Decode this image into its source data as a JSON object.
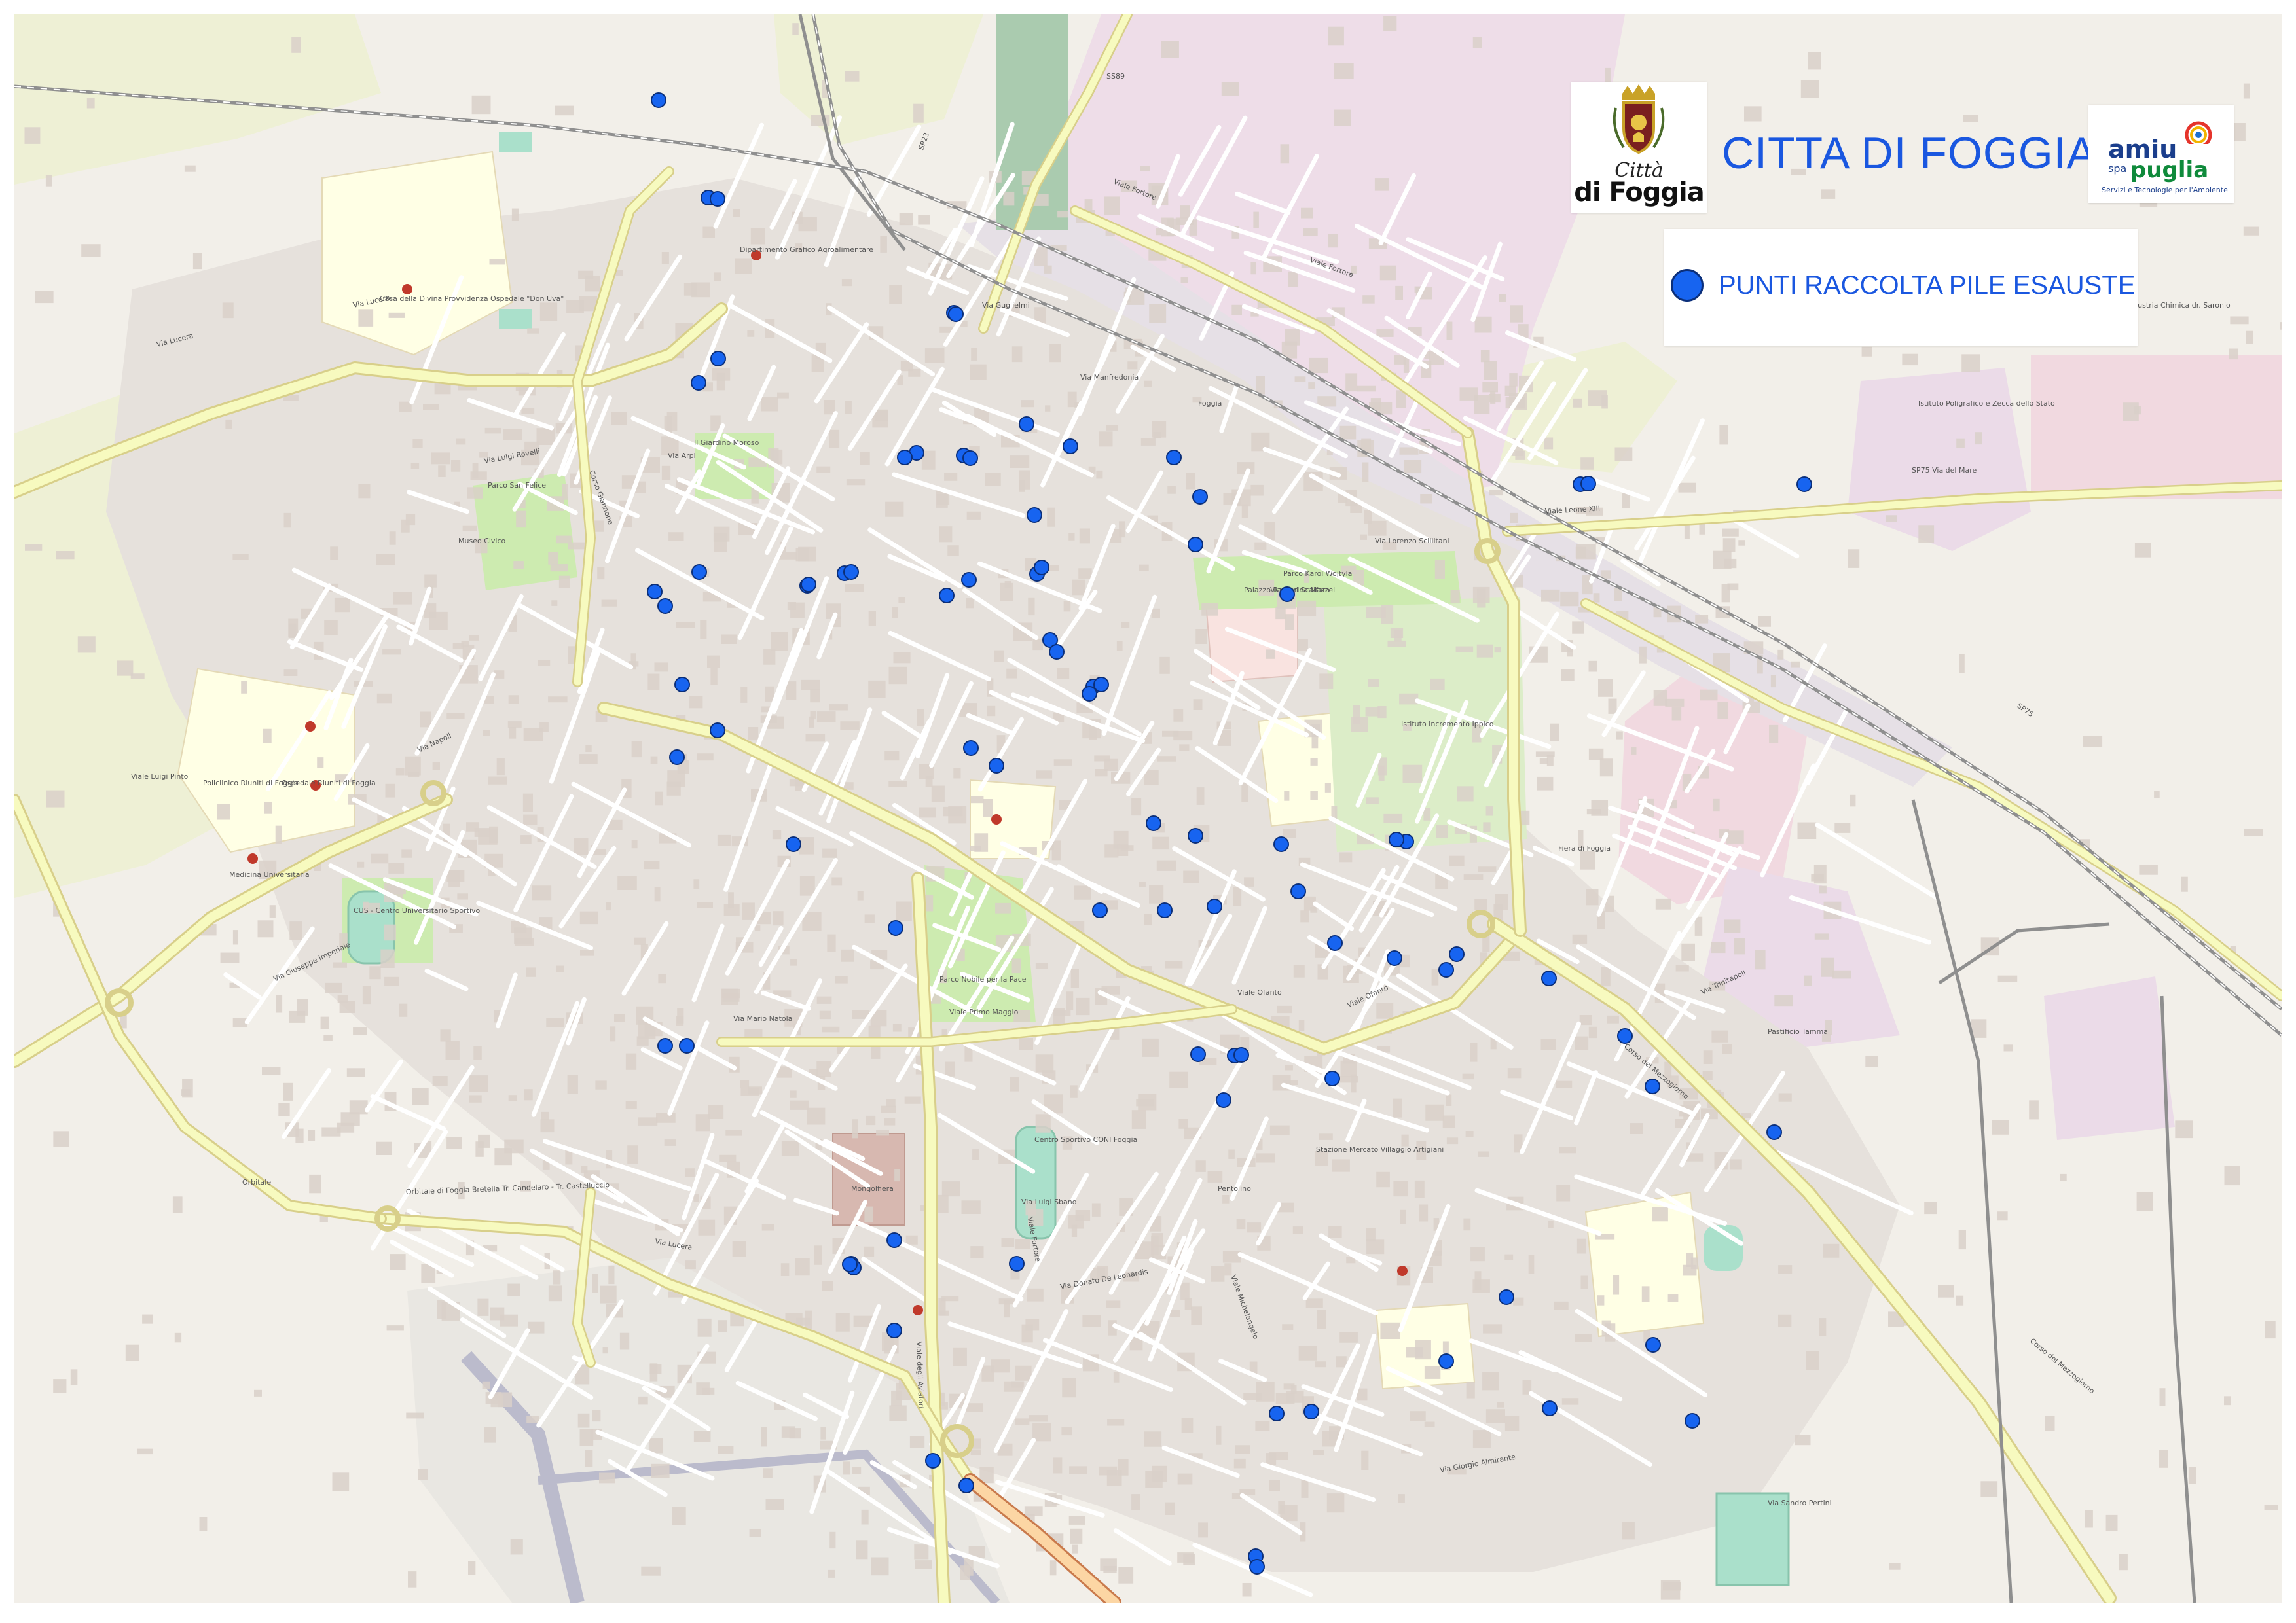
{
  "header": {
    "city_title": "CITTA DI FOGGIA",
    "city_logo_line1": "Città",
    "city_logo_line2": "di Foggia",
    "amiu_logo_name": "amiu",
    "amiu_logo_spa": "spa",
    "amiu_logo_region": "puglia",
    "amiu_logo_tagline": "Servizi e Tecnologie per l'Ambiente"
  },
  "legend": {
    "label": "PUNTI RACCOLTA PILE ESAUSTE",
    "marker_color": "#1764f0",
    "marker_stroke": "#0b2f7a"
  },
  "colors": {
    "map_background": "#f2efe9",
    "building": "#d9d0c9",
    "road": "#ffffff",
    "primary_road": "#f7fabf",
    "residential_pink": "#eedde8",
    "park": "#cdebb0",
    "pitch": "#aae0cb",
    "railway": "#9a9a9a",
    "motorway": "#e892a2",
    "institution": "#ffffe5",
    "industrial": "#ebdbe8",
    "runway": "#bbbbcc",
    "label_text": "#555555",
    "poi_red": "#c0392b"
  },
  "map_labels": [
    {
      "text": "Via Lucera"
    },
    {
      "text": "Via Lucera"
    },
    {
      "text": "Viale Fortore"
    },
    {
      "text": "Via Manfredonia"
    },
    {
      "text": "Via Napoli"
    },
    {
      "text": "Viale Luigi Pinto"
    },
    {
      "text": "Viale Ofanto"
    },
    {
      "text": "Viale Ofanto"
    },
    {
      "text": "Via Mario Natola"
    },
    {
      "text": "Viale Primo Maggio"
    },
    {
      "text": "Corso del Mezzogiorno"
    },
    {
      "text": "Viale Michelangelo"
    },
    {
      "text": "Viale degli Aviatori"
    },
    {
      "text": "Via Trinitapoli"
    },
    {
      "text": "Viale Fortore"
    },
    {
      "text": "Viale Leone XIII"
    },
    {
      "text": "Via Lorenzo Scillitani"
    },
    {
      "text": "Via Marina Mazzei"
    },
    {
      "text": "Via Giuseppe Imperiale"
    },
    {
      "text": "Corso del Mezzogiorno"
    },
    {
      "text": "Corso Giannone"
    },
    {
      "text": "Via Arpi"
    },
    {
      "text": "Via Luigi Rovelli"
    },
    {
      "text": "Via Guglielmi"
    },
    {
      "text": "Via Luigi Sbano"
    },
    {
      "text": "Via Donato De Leonardis"
    },
    {
      "text": "Via Giorgio Almirante"
    },
    {
      "text": "Via Sandro Pertini"
    },
    {
      "text": "Orbitale di Foggia Bretella Tr. Candelaro - Tr. Castelluccio"
    },
    {
      "text": "Orbitale"
    },
    {
      "text": "Via Lucera"
    },
    {
      "text": "Viale Fortore"
    },
    {
      "text": "SP75 Via del Mare"
    },
    {
      "text": "SP75"
    },
    {
      "text": "SP23"
    },
    {
      "text": "SS89"
    },
    {
      "text": "Parco San Felice"
    },
    {
      "text": "Parco Nobile per la Pace"
    },
    {
      "text": "Il Giardino Moroso"
    },
    {
      "text": "Istituto Incremento Ippico"
    },
    {
      "text": "Fiera di Foggia"
    },
    {
      "text": "Istituto Poligrafico e Zecca dello Stato"
    },
    {
      "text": "EX Industria Chimica dr. Saronio"
    },
    {
      "text": "Policlinico Riuniti di Foggia"
    },
    {
      "text": "Ospedale Riuniti di Foggia"
    },
    {
      "text": "Medicina Universitaria"
    },
    {
      "text": "Casa della Divina Provvidenza Ospedale \"Don Uva\""
    },
    {
      "text": "Dipartimento Grafico Agroalimentare"
    },
    {
      "text": "CUS - Centro Universitario Sportivo"
    },
    {
      "text": "Centro Sportivo CONI Foggia"
    },
    {
      "text": "Mongolfiera"
    },
    {
      "text": "Pastificio Tamma"
    },
    {
      "text": "Stazione Mercato Villaggio Artigiani"
    },
    {
      "text": "Palazzo Ranieri Scalfaro"
    },
    {
      "text": "Museo Civico"
    },
    {
      "text": "Foggia"
    },
    {
      "text": "Parco Karol Wojtyla"
    },
    {
      "text": "Pentolino"
    }
  ],
  "battery_collection_points": [
    [
      1006,
      153
    ],
    [
      1082,
      302
    ],
    [
      1096,
      304
    ],
    [
      1097,
      548
    ],
    [
      1067,
      585
    ],
    [
      1457,
      478
    ],
    [
      1460,
      480
    ],
    [
      1400,
      692
    ],
    [
      1382,
      699
    ],
    [
      1472,
      696
    ],
    [
      1482,
      700
    ],
    [
      1568,
      648
    ],
    [
      1635,
      682
    ],
    [
      1580,
      787
    ],
    [
      1584,
      877
    ],
    [
      1480,
      886
    ],
    [
      1446,
      910
    ],
    [
      1591,
      867
    ],
    [
      1793,
      699
    ],
    [
      1833,
      759
    ],
    [
      1826,
      832
    ],
    [
      1966,
      908
    ],
    [
      1068,
      874
    ],
    [
      1290,
      876
    ],
    [
      1300,
      874
    ],
    [
      1233,
      895
    ],
    [
      1235,
      893
    ],
    [
      1000,
      904
    ],
    [
      1016,
      926
    ],
    [
      1042,
      1046
    ],
    [
      1096,
      1116
    ],
    [
      1034,
      1157
    ],
    [
      1604,
      978
    ],
    [
      1614,
      996
    ],
    [
      1670,
      1049
    ],
    [
      1664,
      1060
    ],
    [
      1682,
      1046
    ],
    [
      1483,
      1143
    ],
    [
      1522,
      1170
    ],
    [
      1762,
      1258
    ],
    [
      1826,
      1277
    ],
    [
      1957,
      1290
    ],
    [
      1212,
      1290
    ],
    [
      1368,
      1418
    ],
    [
      1680,
      1391
    ],
    [
      1779,
      1391
    ],
    [
      1855,
      1385
    ],
    [
      1983,
      1362
    ],
    [
      2148,
      1286
    ],
    [
      2133,
      1283
    ],
    [
      2039,
      1441
    ],
    [
      2130,
      1464
    ],
    [
      2225,
      1458
    ],
    [
      2209,
      1482
    ],
    [
      2366,
      1495
    ],
    [
      2482,
      1583
    ],
    [
      2524,
      1660
    ],
    [
      2710,
      1730
    ],
    [
      1016,
      1598
    ],
    [
      1049,
      1598
    ],
    [
      1300,
      1931
    ],
    [
      1304,
      1937
    ],
    [
      1553,
      1931
    ],
    [
      1366,
      1895
    ],
    [
      1886,
      1613
    ],
    [
      1896,
      1612
    ],
    [
      1869,
      1681
    ],
    [
      2035,
      1648
    ],
    [
      1830,
      1611
    ],
    [
      2414,
      740
    ],
    [
      2426,
      739
    ],
    [
      2756,
      740
    ],
    [
      2301,
      1982
    ],
    [
      2525,
      2055
    ],
    [
      2367,
      2152
    ],
    [
      2585,
      2171
    ],
    [
      2209,
      2080
    ],
    [
      2003,
      2157
    ],
    [
      1950,
      2160
    ],
    [
      1918,
      2378
    ],
    [
      1920,
      2394
    ],
    [
      1366,
      2033
    ],
    [
      1425,
      2232
    ],
    [
      1476,
      2270
    ],
    [
      1298,
      1932
    ]
  ]
}
